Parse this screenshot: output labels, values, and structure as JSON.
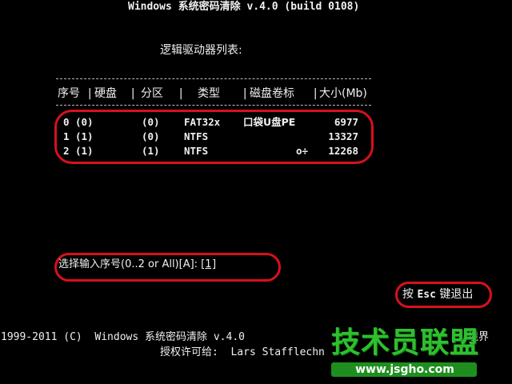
{
  "window": {
    "title": "Windows 系统密码清除 v.4.0 (build 0108)"
  },
  "list": {
    "heading": "逻辑驱动器列表:",
    "columns": [
      "序号",
      "硬盘",
      "分区",
      "类型",
      "磁盘卷标",
      "大小(Mb)"
    ],
    "separator": "|",
    "rows": [
      {
        "index": "0",
        "disk": "(0)",
        "partition": "(0)",
        "type": "FAT32x",
        "label": "口袋U盘PE",
        "size": "6977"
      },
      {
        "index": "1",
        "disk": "(1)",
        "partition": "(0)",
        "type": "NTFS",
        "label": "",
        "size": "13327"
      },
      {
        "index": "2",
        "disk": "(1)",
        "partition": "(1)",
        "type": "NTFS",
        "label": "o÷",
        "size": "12268"
      }
    ]
  },
  "prompt": {
    "text": "选择输入序号(0..2 or All)[A]: [",
    "value": "1",
    "close": "]"
  },
  "esc_hint": {
    "prefix": "按 ",
    "key": "Esc",
    "suffix": " 键退出"
  },
  "footer": {
    "copyright": "1999-2011 (C)  Windows 系统密码清除 v.4.0",
    "license": "授权许可给:  Lars Stafflechn",
    "tail": "境界"
  },
  "watermark": {
    "logo": "技术员联盟",
    "url": "www.jsgho.com"
  },
  "colors": {
    "background": "#000000",
    "text": "#f0f0f0",
    "highlight_box": "#d8101c",
    "watermark_green": "#2fbf2f"
  }
}
